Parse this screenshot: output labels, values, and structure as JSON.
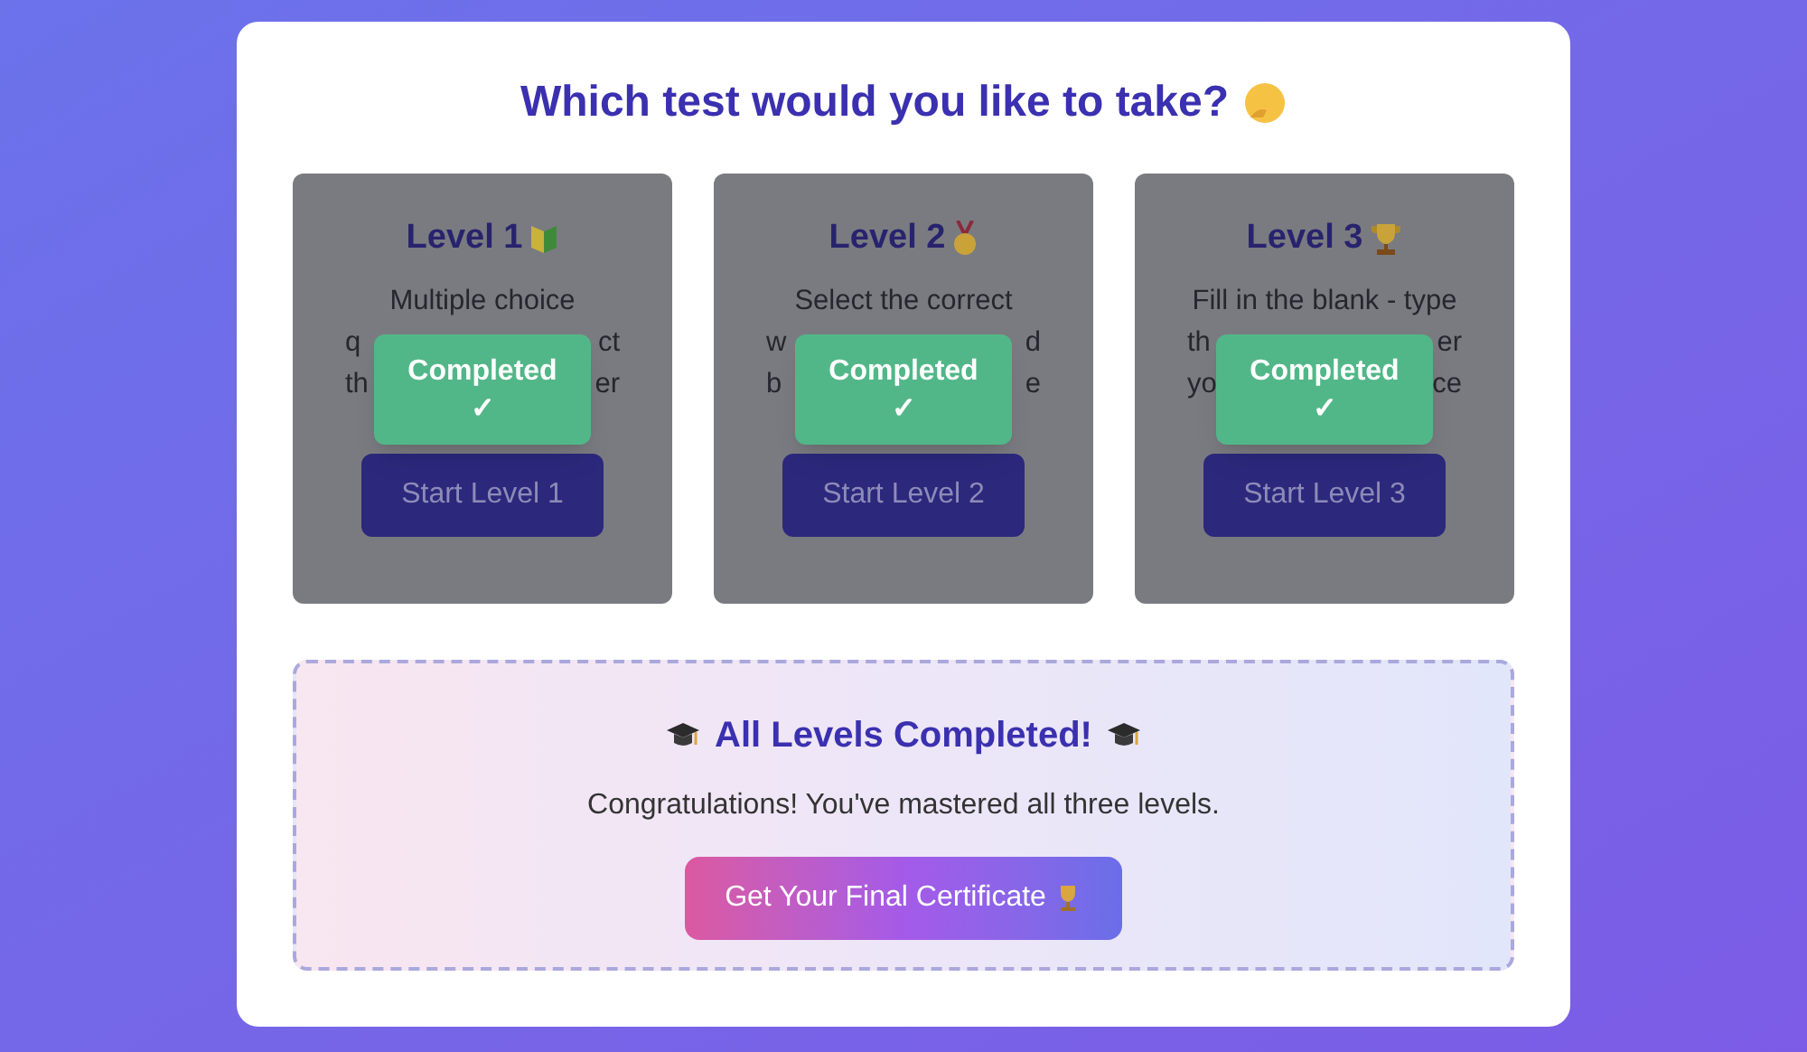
{
  "heading": "Which test would you like to take?",
  "levels": [
    {
      "title": "Level 1",
      "description_lines": [
        {
          "left": "Multiple choice"
        },
        {
          "left": "q",
          "right": "ct"
        },
        {
          "left": "th",
          "right": "er"
        }
      ],
      "completed": true,
      "badge": "Completed",
      "badge_mark": "✓",
      "button": "Start Level 1"
    },
    {
      "title": "Level 2",
      "description_lines": [
        {
          "left": "Select the correct"
        },
        {
          "left": "w",
          "right": "d"
        },
        {
          "left": "b",
          "right": "e"
        }
      ],
      "completed": true,
      "badge": "Completed",
      "badge_mark": "✓",
      "button": "Start Level 2"
    },
    {
      "title": "Level 3",
      "description_lines": [
        {
          "left": "Fill in the blank - type"
        },
        {
          "left": "th",
          "right": "er"
        },
        {
          "left": "yo",
          "right": "ce"
        }
      ],
      "completed": true,
      "badge": "Completed",
      "badge_mark": "✓",
      "button": "Start Level 3"
    }
  ],
  "final": {
    "title": "All Levels Completed!",
    "message": "Congratulations! You've mastered all three levels.",
    "button": "Get Your Final Certificate"
  }
}
